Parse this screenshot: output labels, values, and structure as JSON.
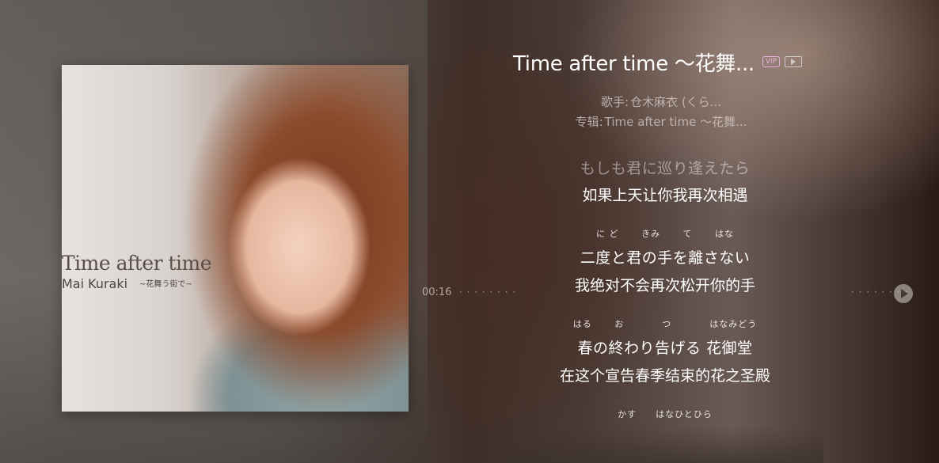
{
  "album_cover": {
    "title_text": "Time after time",
    "artist_text": "Mai Kuraki",
    "subtitle_text": "~花舞う街で~"
  },
  "song": {
    "title": "Time after time ～花舞...",
    "vip_badge": "VIP"
  },
  "meta": {
    "singer_label": "歌手:",
    "singer": "仓木麻衣 (くら...",
    "album_label": "专辑:",
    "album": "Time after time ～花舞..."
  },
  "progress": {
    "current_time": "00:16"
  },
  "lyrics": [
    {
      "ruby": "",
      "ja": "もしも君に巡り逢えたら",
      "zh": "如果上天让你我再次相遇",
      "dim": true
    },
    {
      "ruby": "に ど　　 きみ　 　て　　 はな",
      "ja": "二度と君の手を離さない",
      "zh": "我绝对不会再次松开你的手",
      "dim": false
    },
    {
      "ruby": "はる　　 お　　　　つ　　　　はなみどう",
      "ja": "春の終わり告げる 花御堂",
      "zh": "在这个宣告春季结束的花之圣殿",
      "dim": false
    },
    {
      "ruby": "かす　　はなひとひら",
      "ja": "",
      "zh": "",
      "dim": false
    }
  ],
  "colors": {
    "vip": "#e6b0e0",
    "text_primary": "#ffffff"
  },
  "icons": {
    "mv": "mv-play-icon",
    "play": "play-icon"
  }
}
